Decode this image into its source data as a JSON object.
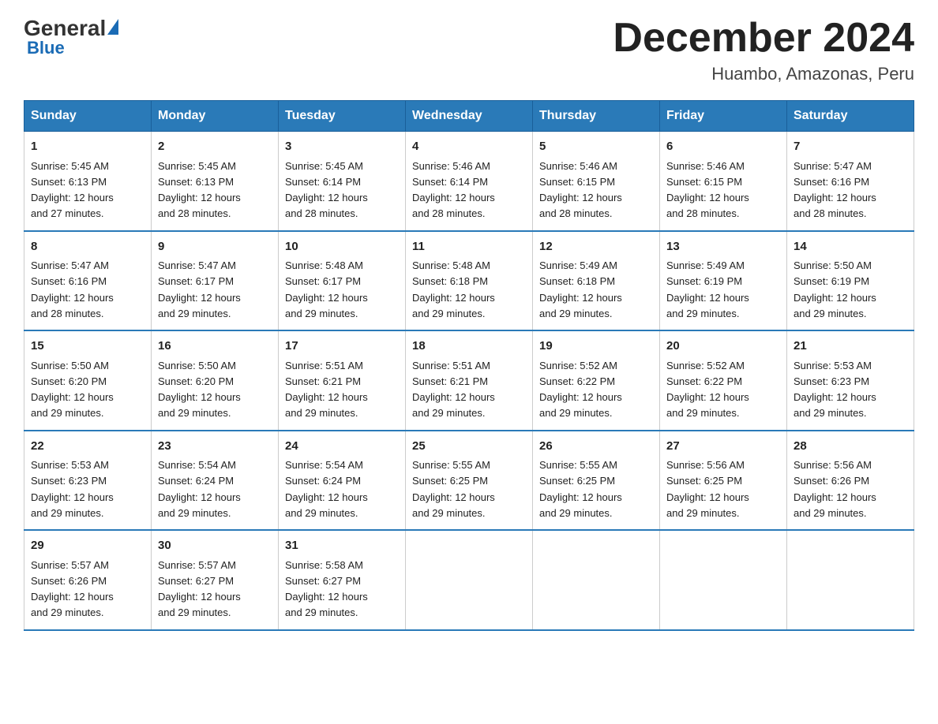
{
  "header": {
    "logo_general": "General",
    "logo_blue": "Blue",
    "month_title": "December 2024",
    "location": "Huambo, Amazonas, Peru"
  },
  "days_of_week": [
    "Sunday",
    "Monday",
    "Tuesday",
    "Wednesday",
    "Thursday",
    "Friday",
    "Saturday"
  ],
  "weeks": [
    [
      {
        "day": "1",
        "sunrise": "5:45 AM",
        "sunset": "6:13 PM",
        "daylight": "12 hours and 27 minutes."
      },
      {
        "day": "2",
        "sunrise": "5:45 AM",
        "sunset": "6:13 PM",
        "daylight": "12 hours and 28 minutes."
      },
      {
        "day": "3",
        "sunrise": "5:45 AM",
        "sunset": "6:14 PM",
        "daylight": "12 hours and 28 minutes."
      },
      {
        "day": "4",
        "sunrise": "5:46 AM",
        "sunset": "6:14 PM",
        "daylight": "12 hours and 28 minutes."
      },
      {
        "day": "5",
        "sunrise": "5:46 AM",
        "sunset": "6:15 PM",
        "daylight": "12 hours and 28 minutes."
      },
      {
        "day": "6",
        "sunrise": "5:46 AM",
        "sunset": "6:15 PM",
        "daylight": "12 hours and 28 minutes."
      },
      {
        "day": "7",
        "sunrise": "5:47 AM",
        "sunset": "6:16 PM",
        "daylight": "12 hours and 28 minutes."
      }
    ],
    [
      {
        "day": "8",
        "sunrise": "5:47 AM",
        "sunset": "6:16 PM",
        "daylight": "12 hours and 28 minutes."
      },
      {
        "day": "9",
        "sunrise": "5:47 AM",
        "sunset": "6:17 PM",
        "daylight": "12 hours and 29 minutes."
      },
      {
        "day": "10",
        "sunrise": "5:48 AM",
        "sunset": "6:17 PM",
        "daylight": "12 hours and 29 minutes."
      },
      {
        "day": "11",
        "sunrise": "5:48 AM",
        "sunset": "6:18 PM",
        "daylight": "12 hours and 29 minutes."
      },
      {
        "day": "12",
        "sunrise": "5:49 AM",
        "sunset": "6:18 PM",
        "daylight": "12 hours and 29 minutes."
      },
      {
        "day": "13",
        "sunrise": "5:49 AM",
        "sunset": "6:19 PM",
        "daylight": "12 hours and 29 minutes."
      },
      {
        "day": "14",
        "sunrise": "5:50 AM",
        "sunset": "6:19 PM",
        "daylight": "12 hours and 29 minutes."
      }
    ],
    [
      {
        "day": "15",
        "sunrise": "5:50 AM",
        "sunset": "6:20 PM",
        "daylight": "12 hours and 29 minutes."
      },
      {
        "day": "16",
        "sunrise": "5:50 AM",
        "sunset": "6:20 PM",
        "daylight": "12 hours and 29 minutes."
      },
      {
        "day": "17",
        "sunrise": "5:51 AM",
        "sunset": "6:21 PM",
        "daylight": "12 hours and 29 minutes."
      },
      {
        "day": "18",
        "sunrise": "5:51 AM",
        "sunset": "6:21 PM",
        "daylight": "12 hours and 29 minutes."
      },
      {
        "day": "19",
        "sunrise": "5:52 AM",
        "sunset": "6:22 PM",
        "daylight": "12 hours and 29 minutes."
      },
      {
        "day": "20",
        "sunrise": "5:52 AM",
        "sunset": "6:22 PM",
        "daylight": "12 hours and 29 minutes."
      },
      {
        "day": "21",
        "sunrise": "5:53 AM",
        "sunset": "6:23 PM",
        "daylight": "12 hours and 29 minutes."
      }
    ],
    [
      {
        "day": "22",
        "sunrise": "5:53 AM",
        "sunset": "6:23 PM",
        "daylight": "12 hours and 29 minutes."
      },
      {
        "day": "23",
        "sunrise": "5:54 AM",
        "sunset": "6:24 PM",
        "daylight": "12 hours and 29 minutes."
      },
      {
        "day": "24",
        "sunrise": "5:54 AM",
        "sunset": "6:24 PM",
        "daylight": "12 hours and 29 minutes."
      },
      {
        "day": "25",
        "sunrise": "5:55 AM",
        "sunset": "6:25 PM",
        "daylight": "12 hours and 29 minutes."
      },
      {
        "day": "26",
        "sunrise": "5:55 AM",
        "sunset": "6:25 PM",
        "daylight": "12 hours and 29 minutes."
      },
      {
        "day": "27",
        "sunrise": "5:56 AM",
        "sunset": "6:25 PM",
        "daylight": "12 hours and 29 minutes."
      },
      {
        "day": "28",
        "sunrise": "5:56 AM",
        "sunset": "6:26 PM",
        "daylight": "12 hours and 29 minutes."
      }
    ],
    [
      {
        "day": "29",
        "sunrise": "5:57 AM",
        "sunset": "6:26 PM",
        "daylight": "12 hours and 29 minutes."
      },
      {
        "day": "30",
        "sunrise": "5:57 AM",
        "sunset": "6:27 PM",
        "daylight": "12 hours and 29 minutes."
      },
      {
        "day": "31",
        "sunrise": "5:58 AM",
        "sunset": "6:27 PM",
        "daylight": "12 hours and 29 minutes."
      },
      null,
      null,
      null,
      null
    ]
  ],
  "labels": {
    "sunrise": "Sunrise:",
    "sunset": "Sunset:",
    "daylight": "Daylight:"
  }
}
